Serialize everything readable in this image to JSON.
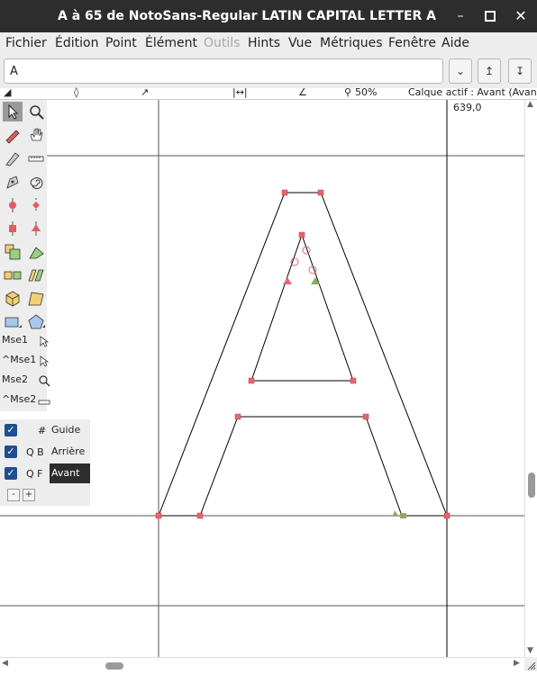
{
  "window": {
    "title": "A à 65 de NotoSans-Regular LATIN CAPITAL LETTER A",
    "minimize_icon": "minimize-icon",
    "maximize_icon": "maximize-icon",
    "close_icon": "close-icon"
  },
  "menu": [
    "Fichier",
    "Édition",
    "Point",
    "Élément",
    "Outils",
    "Hints",
    "Vue",
    "Métriques",
    "Fenêtre",
    "Aide"
  ],
  "menu_disabled": "Outils",
  "glyph_entry": {
    "value": "A"
  },
  "infobar": {
    "zoom": "50%",
    "layer": "Calque actif : Avant (Avant"
  },
  "canvas": {
    "coord_readout": "639,0"
  },
  "mouse_bindings": [
    "Mse1",
    "^Mse1",
    "Mse2",
    "^Mse2"
  ],
  "layers": [
    {
      "flags": "#",
      "name": "Guide",
      "checked": true
    },
    {
      "flags": "Q B",
      "name": "Arrière",
      "checked": true
    },
    {
      "flags": "Q F",
      "name": "Avant",
      "checked": true,
      "active": true
    }
  ],
  "layer_buttons": [
    "-",
    "+"
  ],
  "colors": {
    "titlebar": "#2d2d2d",
    "menubar": "#ededed",
    "point": "#e8646e",
    "active_layer": "#2d2d2d"
  }
}
